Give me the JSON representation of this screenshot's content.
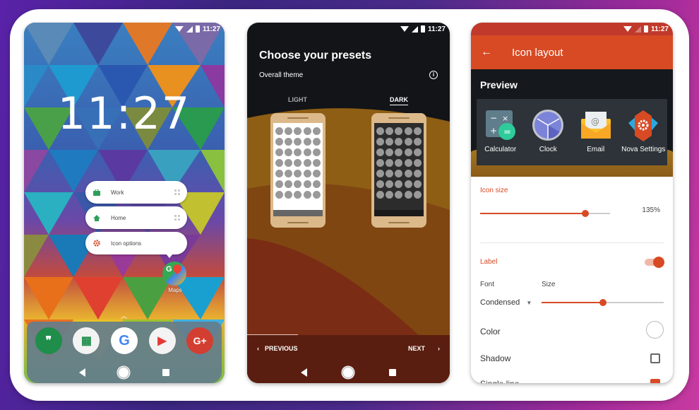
{
  "status_time": "11:27",
  "phone1": {
    "clock": "11:27",
    "shortcuts": [
      {
        "label": "Work",
        "icon": "briefcase-icon",
        "color": "#2e9e5b",
        "draggable": true
      },
      {
        "label": "Home",
        "icon": "home-icon",
        "color": "#2e9e5b",
        "draggable": true
      },
      {
        "label": "Icon options",
        "icon": "gear-icon",
        "color": "#d84a24",
        "draggable": false
      }
    ],
    "maps_label": "Maps",
    "dock": [
      {
        "name": "hangouts",
        "glyph": "❞",
        "bg": "#1e8e4a",
        "fg": "#fff"
      },
      {
        "name": "sheets-play",
        "glyph": "▦",
        "bg": "#f3f3f3",
        "fg": "#1e8e4a"
      },
      {
        "name": "google",
        "glyph": "G",
        "bg": "#ffffff",
        "fg": "#4285f4"
      },
      {
        "name": "youtube-studio",
        "glyph": "▶",
        "bg": "#f3f3f3",
        "fg": "#e53935"
      },
      {
        "name": "google-plus",
        "glyph": "G+",
        "bg": "#d23f31",
        "fg": "#fff"
      }
    ]
  },
  "phone2": {
    "title": "Choose your presets",
    "subtitle": "Overall theme",
    "info_glyph": "i",
    "tabs": [
      {
        "label": "LIGHT",
        "active": false
      },
      {
        "label": "DARK",
        "active": true
      }
    ],
    "previous_label": "PREVIOUS",
    "next_label": "NEXT",
    "progress": 0.25
  },
  "phone3": {
    "title": "Icon layout",
    "preview_title": "Preview",
    "apps": [
      {
        "name": "Calculator"
      },
      {
        "name": "Clock"
      },
      {
        "name": "Email"
      },
      {
        "name": "Nova Settings"
      }
    ],
    "icon_size_label": "Icon size",
    "icon_size_value": "135%",
    "icon_size_fraction": 0.81,
    "label_section": "Label",
    "label_enabled": true,
    "font_label": "Font",
    "font_value": "Condensed",
    "size_label": "Size",
    "size_fraction": 0.5,
    "color_label": "Color",
    "shadow_label": "Shadow",
    "shadow_checked": false,
    "single_line_label": "Single line",
    "single_line_checked": true,
    "accent": "#d84a24"
  }
}
